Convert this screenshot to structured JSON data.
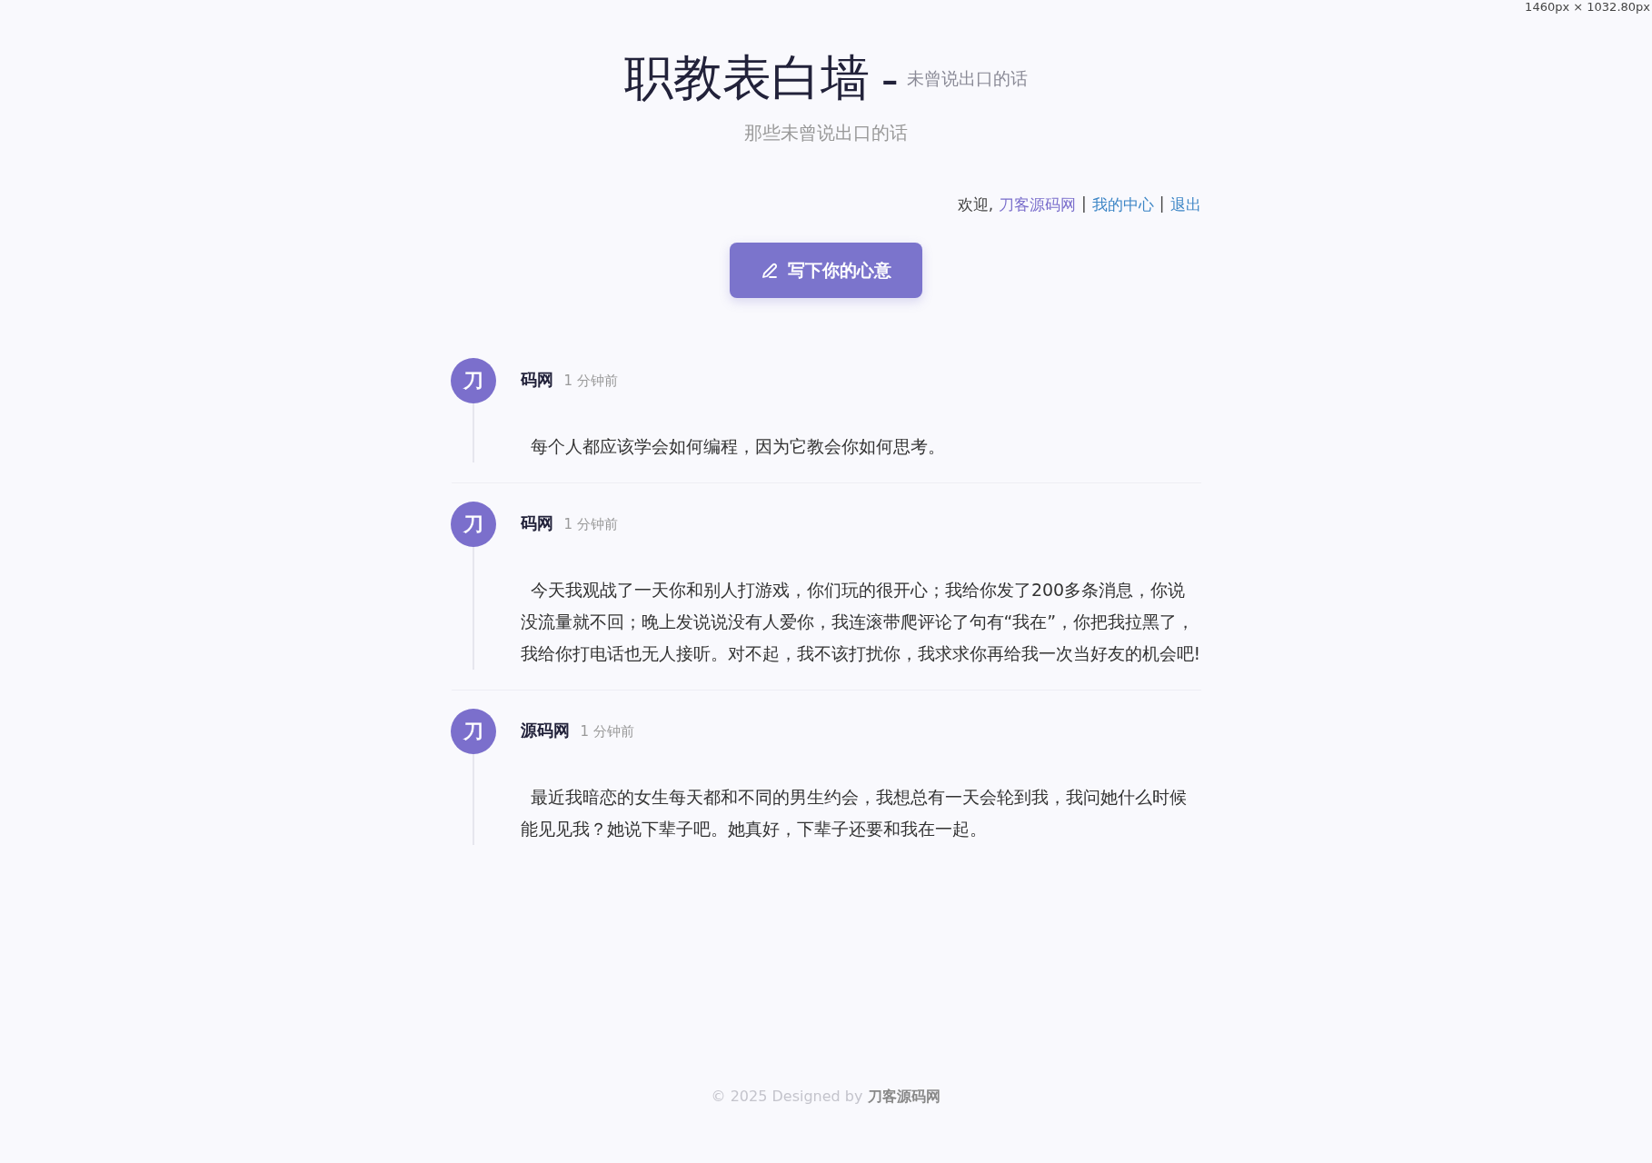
{
  "viewport_label": "1460px × 1032.80px",
  "header": {
    "title": "职教表白墙 -",
    "title_fragment": "未曾说出口的话",
    "subtitle": "那些未曾说出口的话"
  },
  "user_bar": {
    "welcome": "欢迎,",
    "username": "刀客源码网",
    "separator_1": "|",
    "my_center": "我的中心",
    "separator_2": "|",
    "logout": "退出"
  },
  "write_button": {
    "label": "写下你的心意"
  },
  "posts": [
    {
      "avatar": "刀",
      "author": "码网",
      "time": "1 分钟前",
      "content": "每个人都应该学会如何编程，因为它教会你如何思考。"
    },
    {
      "avatar": "刀",
      "author": "码网",
      "time": "1 分钟前",
      "content": "今天我观战了一天你和别人打游戏，你们玩的很开心；我给你发了200多条消息，你说没流量就不回；晚上发说说没有人爱你，我连滚带爬评论了句有“我在”，你把我拉黑了，我给你打电话也无人接听。对不起，我不该打扰你，我求求你再给我一次当好友的机会吧!"
    },
    {
      "avatar": "刀",
      "author": "源码网",
      "time": "1 分钟前",
      "content": "最近我暗恋的女生每天都和不同的男生约会，我想总有一天会轮到我，我问她什么时候能见见我？她说下辈子吧。她真好，下辈子还要和我在一起。"
    }
  ],
  "footer": {
    "text": "© 2025 Designed by",
    "brand": "刀客源码网"
  }
}
